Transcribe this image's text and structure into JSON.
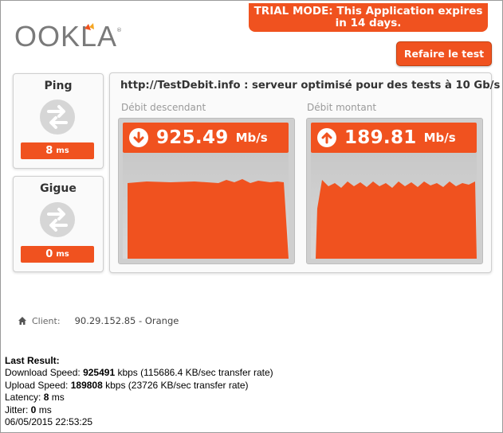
{
  "banner": {
    "line1": "TRIAL MODE: This Application expires",
    "line2": "in 14 days."
  },
  "logo": {
    "text": "OOKLA"
  },
  "retest_button": {
    "label": "Refaire le test"
  },
  "ping": {
    "title": "Ping",
    "value": "8",
    "unit": "ms"
  },
  "jitter": {
    "title": "Gigue",
    "value": "0",
    "unit": "ms"
  },
  "server": {
    "text": "http://TestDebit.info : serveur optimisé pour des tests à 10 Gb/s"
  },
  "download": {
    "label": "Débit descendant",
    "value": "925.49",
    "unit": "Mb/s"
  },
  "upload": {
    "label": "Débit montant",
    "value": "189.81",
    "unit": "Mb/s"
  },
  "client": {
    "label": "Client:",
    "value": "90.29.152.85 - Orange"
  },
  "last_result": {
    "header": "Last Result:",
    "download_prefix": "Download Speed: ",
    "download_value": "925491",
    "download_suffix": " kbps (115686.4 KB/sec transfer rate)",
    "upload_prefix": "Upload Speed: ",
    "upload_value": "189808",
    "upload_suffix": " kbps (23726 KB/sec transfer rate)",
    "latency_prefix": "Latency: ",
    "latency_value": "8",
    "latency_suffix": " ms",
    "jitter_prefix": "Jitter: ",
    "jitter_value": "0",
    "jitter_suffix": " ms",
    "timestamp": "06/05/2015 22:53:25"
  },
  "colors": {
    "accent": "#f0521f",
    "panel": "#fafafa",
    "graph_bg": "#cfcfcf"
  }
}
